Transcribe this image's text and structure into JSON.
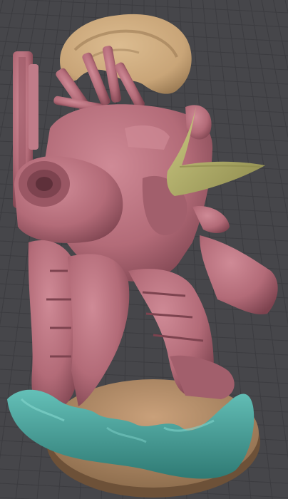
{
  "viewport": {
    "background": "#46464a",
    "grid_color": "#5b5b62",
    "grid_line_color": "#3c3c40"
  },
  "model": {
    "colors": {
      "body": "#b36b78",
      "body_dark": "#7d434f",
      "body_light": "#cf8a96",
      "hair": "#c9a578",
      "hair_dark": "#9c7c55",
      "blade": "#b7b46d",
      "blade_dark": "#8d8a4d",
      "base": "#b58f68",
      "base_dark": "#8c6c4c",
      "water": "#4ba59e",
      "water_dark": "#2f7a74"
    },
    "parts": [
      "head-plume",
      "backpack-exhaust-pipes",
      "torso-armor",
      "shoulder-cannon",
      "blade-fin",
      "legs",
      "base-disc",
      "water-splash"
    ]
  }
}
